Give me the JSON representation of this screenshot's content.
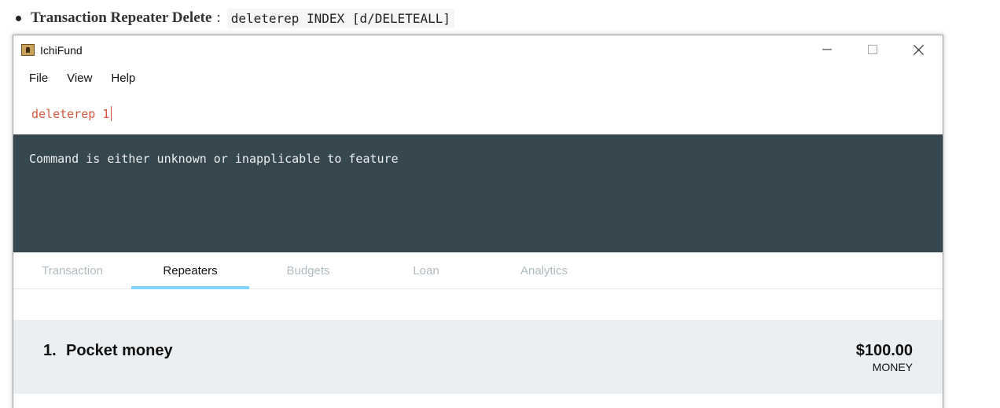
{
  "doc": {
    "title": "Transaction Repeater Delete",
    "colon": ":",
    "command_format": "deleterep INDEX [d/DELETEALL]"
  },
  "window": {
    "title": "IchiFund",
    "controls": {
      "minimize": "minimize-icon",
      "maximize": "maximize-icon",
      "close": "close-icon"
    }
  },
  "menu": {
    "items": [
      "File",
      "View",
      "Help"
    ]
  },
  "command_box": {
    "value": "deleterep 1"
  },
  "result": {
    "message": "Command is either unknown or inapplicable to feature"
  },
  "tabs": [
    {
      "label": "Transaction",
      "active": false
    },
    {
      "label": "Repeaters",
      "active": true
    },
    {
      "label": "Budgets",
      "active": false
    },
    {
      "label": "Loan",
      "active": false
    },
    {
      "label": "Analytics",
      "active": false
    }
  ],
  "repeaters": [
    {
      "index": "1.",
      "name": "Pocket money",
      "amount": "$100.00",
      "category": "MONEY"
    }
  ],
  "colors": {
    "command_text": "#d9583b",
    "result_bg": "#37474f",
    "tab_indicator": "#81d4fa",
    "card_bg": "#eceff1"
  }
}
